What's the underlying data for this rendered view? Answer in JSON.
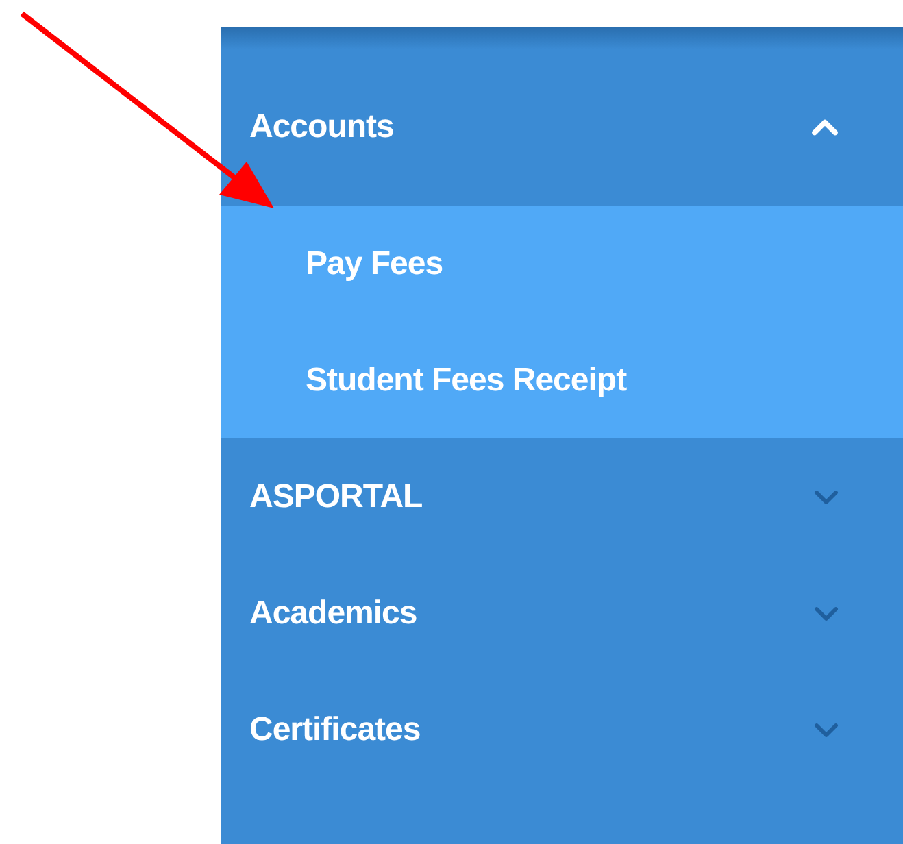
{
  "sidebar": {
    "items": [
      {
        "label": "Accounts",
        "expanded": true,
        "children": [
          {
            "label": "Pay Fees"
          },
          {
            "label": "Student Fees Receipt"
          }
        ]
      },
      {
        "label": "ASPORTAL",
        "expanded": false
      },
      {
        "label": "Academics",
        "expanded": false
      },
      {
        "label": "Certificates",
        "expanded": false
      }
    ]
  }
}
